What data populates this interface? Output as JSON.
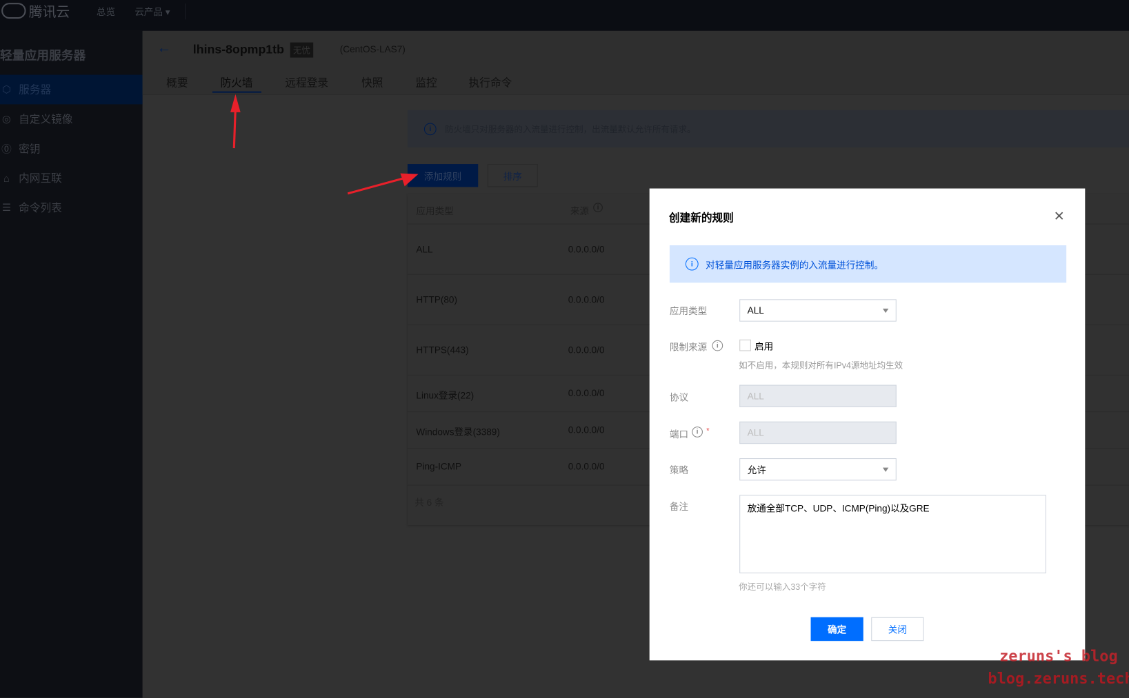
{
  "topbar": {
    "logo": "腾讯云",
    "nav": [
      "总览",
      "云产品 ▾"
    ]
  },
  "sidebar": {
    "title": "轻量应用服务器",
    "items": [
      {
        "label": "服务器",
        "icon": "cube-icon",
        "active": true
      },
      {
        "label": "自定义镜像",
        "icon": "disc-icon"
      },
      {
        "label": "密钥",
        "icon": "key-icon"
      },
      {
        "label": "内网互联",
        "icon": "network-icon"
      },
      {
        "label": "命令列表",
        "icon": "list-icon"
      }
    ]
  },
  "header": {
    "back": "←",
    "instance": "lhins-8opmp1tb",
    "badge": "无忧",
    "os": "(CentOS-LAS7)",
    "tabs": [
      "概要",
      "防火墙",
      "远程登录",
      "快照",
      "监控",
      "执行命令"
    ],
    "active_tab": "防火墙"
  },
  "firewall": {
    "info": "防火墙只对服务器的入流量进行控制，出流量默认允许所有请求。",
    "add_rule": "添加规则",
    "sort": "排序",
    "columns": [
      "应用类型",
      "来源"
    ],
    "rows": [
      {
        "type": "ALL",
        "source": "0.0.0.0/0"
      },
      {
        "type": "HTTP(80)",
        "source": "0.0.0.0/0"
      },
      {
        "type": "HTTPS(443)",
        "source": "0.0.0.0/0"
      },
      {
        "type": "Linux登录(22)",
        "source": "0.0.0.0/0"
      },
      {
        "type": "Windows登录(3389)",
        "source": "0.0.0.0/0"
      },
      {
        "type": "Ping-ICMP",
        "source": "0.0.0.0/0"
      }
    ],
    "total": "共 6 条"
  },
  "modal": {
    "title": "创建新的规则",
    "close": "×",
    "info": "对轻量应用服务器实例的入流量进行控制。",
    "app_type_label": "应用类型",
    "app_type_value": "ALL",
    "restrict_label": "限制来源",
    "restrict_checkbox": "启用",
    "restrict_checked": false,
    "restrict_hint": "如不启用，本规则对所有IPv4源地址均生效",
    "protocol_label": "协议",
    "protocol_value": "ALL",
    "port_label": "端口",
    "port_value": "ALL",
    "required_mark": "*",
    "policy_label": "策略",
    "policy_value": "允许",
    "note_label": "备注",
    "note_value": "放通全部TCP、UDP、ICMP(Ping)以及GRE",
    "note_hint": "你还可以输入33个字符",
    "confirm": "确定",
    "cancel": "关闭"
  },
  "colors": {
    "primary": "#006eff",
    "arrow": "#e8202a",
    "info_bg": "#d5e6ff"
  },
  "watermark": [
    "zeruns's blog",
    "blog.zeruns.tech"
  ]
}
